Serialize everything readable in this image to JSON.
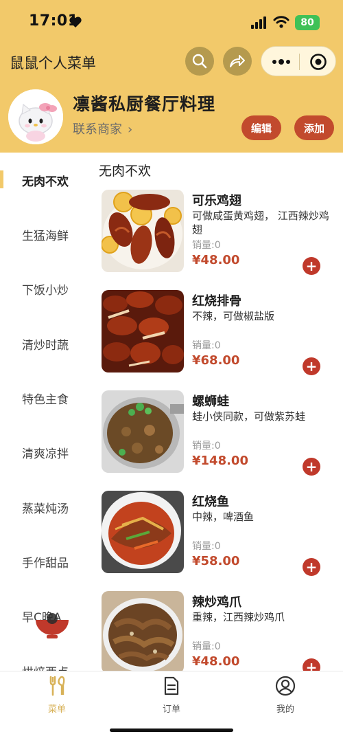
{
  "status_bar": {
    "time": "17:01",
    "battery": "80"
  },
  "nav": {
    "title": "鼠鼠个人菜单"
  },
  "shop": {
    "name": "凛酱私厨餐厅料理",
    "contact_label": "联系商家",
    "edit_label": "编辑",
    "add_label": "添加"
  },
  "categories": [
    {
      "label": "无肉不欢"
    },
    {
      "label": "生猛海鲜"
    },
    {
      "label": "下饭小炒"
    },
    {
      "label": "清炒时蔬"
    },
    {
      "label": "特色主食"
    },
    {
      "label": "清爽凉拌"
    },
    {
      "label": "蒸菜炖汤"
    },
    {
      "label": "手作甜品"
    },
    {
      "label": "早C晚A"
    },
    {
      "label": "烘焙西点"
    }
  ],
  "section_title": "无肉不欢",
  "dishes": [
    {
      "name": "可乐鸡翅",
      "desc": "可做咸蛋黄鸡翅，  江西辣炒鸡翅",
      "sales": "销量:0",
      "price": "¥48.00"
    },
    {
      "name": "红烧排骨",
      "desc": "不辣，可做椒盐版",
      "sales": "销量:0",
      "price": "¥68.00"
    },
    {
      "name": "螺蛳蛙",
      "desc": "蛙小侠同款，可做紫苏蛙",
      "sales": "销量:0",
      "price": "¥148.00"
    },
    {
      "name": "红烧鱼",
      "desc": "中辣，啤酒鱼",
      "sales": "销量:0",
      "price": "¥58.00"
    },
    {
      "name": "辣炒鸡爪",
      "desc": "重辣，江西辣炒鸡爪",
      "sales": "销量:0",
      "price": "¥48.00"
    }
  ],
  "tabs": [
    {
      "label": "菜单",
      "icon": "fork-knife-icon"
    },
    {
      "label": "订单",
      "icon": "document-icon"
    },
    {
      "label": "我的",
      "icon": "user-icon"
    }
  ],
  "colors": {
    "header_bg": "#f2c96a",
    "accent_red": "#c24a2d",
    "tab_active": "#d8b259"
  }
}
